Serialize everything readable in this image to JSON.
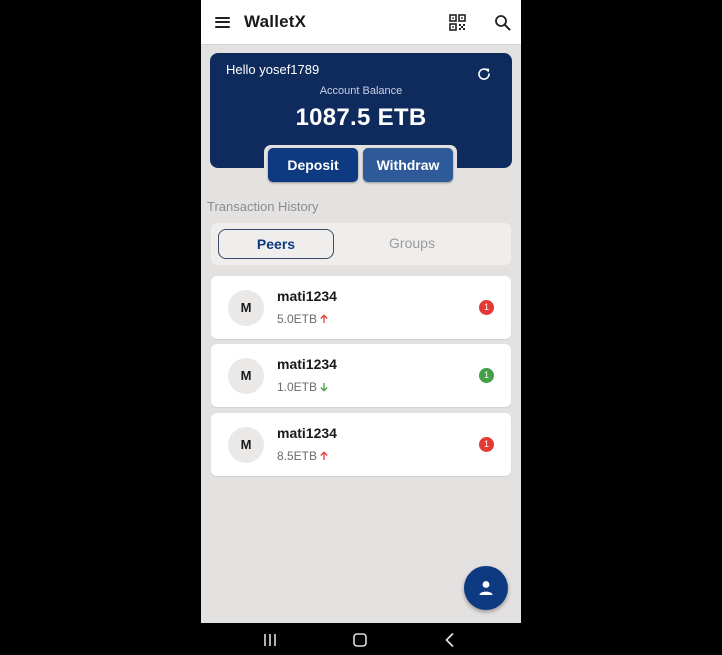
{
  "app": {
    "title": "WalletX"
  },
  "icons": {
    "menu": "menu-icon",
    "qr": "qr-code-icon",
    "search": "search-icon",
    "refresh": "refresh-icon",
    "fab": "person-icon"
  },
  "balance": {
    "greeting": "Hello yosef1789",
    "label": "Account Balance",
    "amount": "1087.5 ETB"
  },
  "actions": {
    "deposit": "Deposit",
    "withdraw": "Withdraw"
  },
  "history": {
    "title": "Transaction History",
    "tabs": [
      {
        "label": "Peers",
        "active": true
      },
      {
        "label": "Groups",
        "active": false
      }
    ]
  },
  "transactions": [
    {
      "avatar": "M",
      "name": "mati1234",
      "amount": "5.0ETB",
      "direction": "up",
      "count": "1",
      "badge_color": "#e53935"
    },
    {
      "avatar": "M",
      "name": "mati1234",
      "amount": "1.0ETB",
      "direction": "down",
      "count": "1",
      "badge_color": "#43a047"
    },
    {
      "avatar": "M",
      "name": "mati1234",
      "amount": "8.5ETB",
      "direction": "up",
      "count": "1",
      "badge_color": "#e53935"
    }
  ],
  "colors": {
    "primary": "#0e3a82",
    "card": "#0f2a5c",
    "up_arrow": "#e53935",
    "down_arrow": "#43a047"
  },
  "system_nav": {
    "recents": "recents-icon",
    "home": "home-icon",
    "back": "back-icon"
  }
}
